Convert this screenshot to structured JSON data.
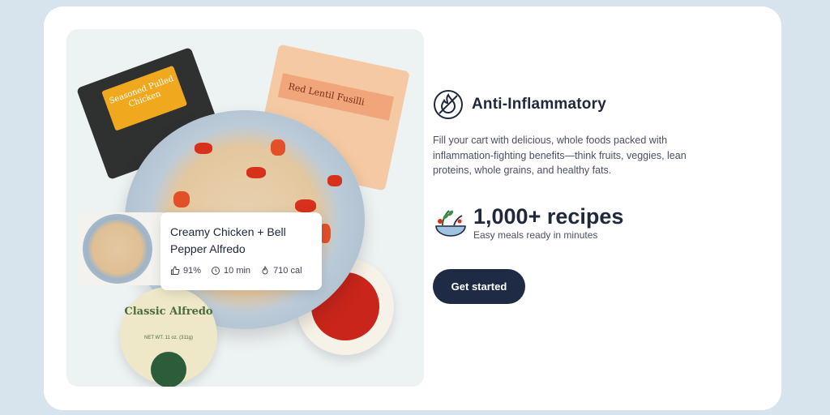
{
  "hero": {
    "chicken_pack_label": "Seasoned Pulled Chicken",
    "pasta_pack_label": "Red Lentil Fusilli",
    "sauce_label": "Classic Alfredo",
    "sauce_net_weight": "NET WT. 11 oz. (311g)",
    "recipe": {
      "title": "Creamy Chicken + Bell Pepper Alfredo",
      "rating": "91%",
      "time": "10 min",
      "calories": "710 cal"
    }
  },
  "feature": {
    "title": "Anti-Inflammatory",
    "icon": "flame-icon",
    "description": "Fill your cart with delicious, whole foods packed with inflammation-fighting benefits—think fruits, veggies, lean proteins, whole grains, and healthy fats."
  },
  "stat": {
    "icon": "salad-bowl-icon",
    "value": "1,000+ recipes",
    "caption": "Easy meals ready in minutes"
  },
  "cta": {
    "label": "Get started"
  },
  "colors": {
    "page_bg": "#d7e4ee",
    "navy": "#1f2b45",
    "text_dark": "#20283d",
    "text_body": "#4a5062"
  }
}
